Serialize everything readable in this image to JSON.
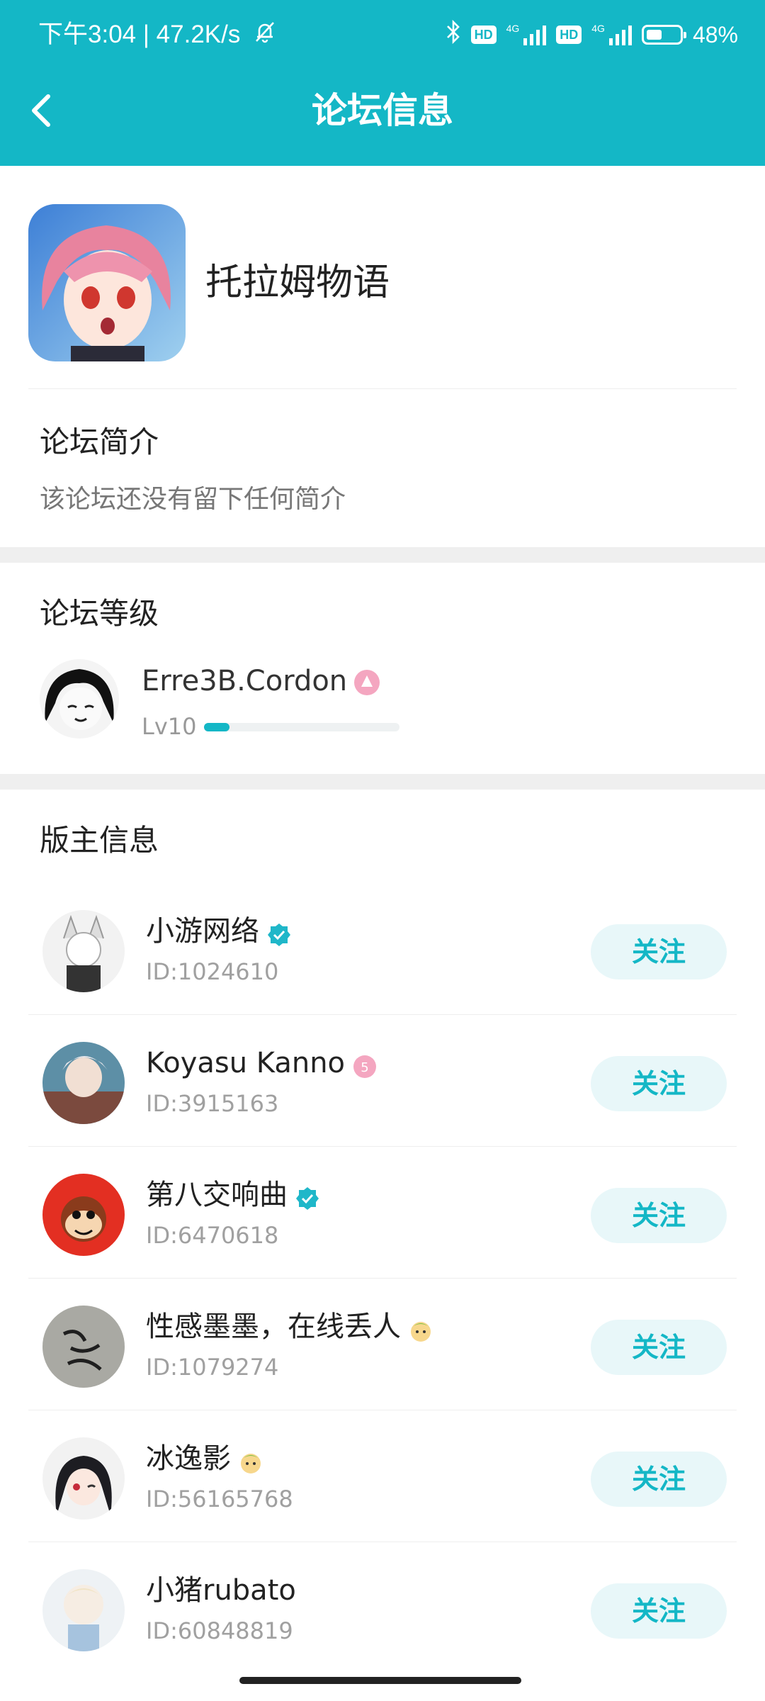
{
  "status_bar": {
    "time_speed": "下午3:04 | 47.2K/s",
    "hd": "HD",
    "network": "4G",
    "battery": "48%",
    "battery_level": 0.48
  },
  "header": {
    "title": "论坛信息",
    "back_icon": "back-arrow-icon"
  },
  "forum": {
    "name": "托拉姆物语"
  },
  "intro": {
    "title": "论坛简介",
    "text": "该论坛还没有留下任何简介"
  },
  "level": {
    "title": "论坛等级",
    "user_name": "Erre3B.Cordon",
    "level_label": "Lv10",
    "progress": 0.13
  },
  "moderators": {
    "title": "版主信息",
    "follow_label": "关注",
    "items": [
      {
        "name": "小游网络",
        "id": "ID:1024610",
        "badge": "verified-icon"
      },
      {
        "name": "Koyasu Kanno",
        "id": "ID:3915163",
        "badge": "level-badge-icon"
      },
      {
        "name": "第八交响曲",
        "id": "ID:6470618",
        "badge": "verified-icon"
      },
      {
        "name": "性感墨墨，在线丢人",
        "id": "ID:1079274",
        "badge": "emoji-badge-icon"
      },
      {
        "name": "冰逸影",
        "id": "ID:56165768",
        "badge": "emoji-badge-icon"
      },
      {
        "name": "小猪rubato",
        "id": "ID:60848819",
        "badge": ""
      }
    ]
  },
  "colors": {
    "accent": "#14b7c6",
    "follow_bg": "#e8f7f9",
    "secondary_text": "#a0a0a0"
  }
}
